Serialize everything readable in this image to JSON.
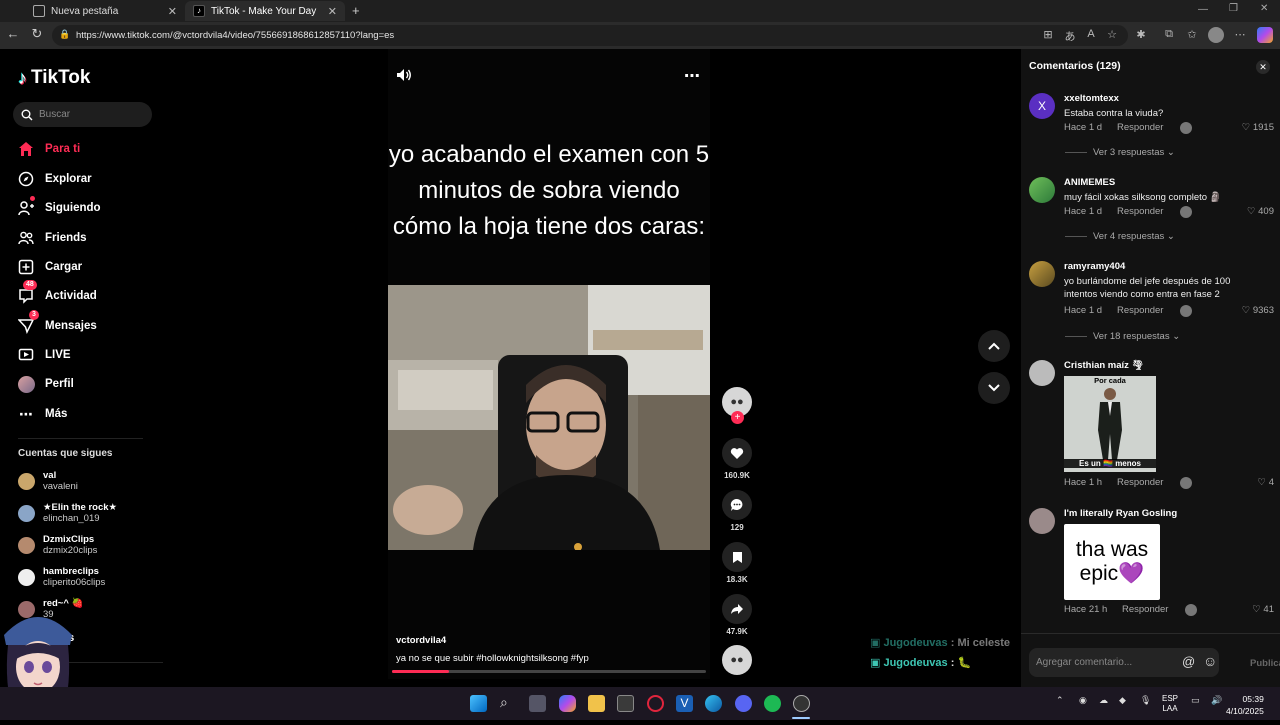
{
  "browser": {
    "tabs": [
      {
        "title": "Nueva pestaña"
      },
      {
        "title": "TikTok - Make Your Day"
      }
    ],
    "url": "https://www.tiktok.com/@vctordvila4/video/7556691868612857110?lang=es"
  },
  "sidebar": {
    "logo": "TikTok",
    "search_placeholder": "Buscar",
    "nav": [
      {
        "label": "Para ti",
        "icon": "home-icon"
      },
      {
        "label": "Explorar",
        "icon": "compass-icon"
      },
      {
        "label": "Siguiendo",
        "icon": "following-icon"
      },
      {
        "label": "Friends",
        "icon": "friends-icon"
      },
      {
        "label": "Cargar",
        "icon": "upload-icon"
      },
      {
        "label": "Actividad",
        "icon": "activity-icon",
        "badge": "48"
      },
      {
        "label": "Mensajes",
        "icon": "messages-icon",
        "badge": "3"
      },
      {
        "label": "LIVE",
        "icon": "live-icon"
      },
      {
        "label": "Perfil",
        "icon": "profile-icon"
      },
      {
        "label": "Más",
        "icon": "more-icon"
      }
    ],
    "following_header": "Cuentas que sigues",
    "following": [
      {
        "name": "val",
        "handle": "vavaleni"
      },
      {
        "name": "★Elin the rock★",
        "handle": "elinchan_019"
      },
      {
        "name": "DzmixClips",
        "handle": "dzmix20clips"
      },
      {
        "name": "hambreclips",
        "handle": "cliperito06clips"
      },
      {
        "name": "red~^ 🍓",
        "handle": "39"
      }
    ],
    "more_label": "ás"
  },
  "video": {
    "caption": "yo acabando el examen con 5 minutos de sobra viendo cómo la hoja tiene dos caras:",
    "author": "vctordvila4",
    "description": "ya no se que subir #hollowknightsilksong  #fyp",
    "progress": 0.18,
    "likes": "160.9K",
    "comments": "129",
    "saves": "18.3K",
    "shares": "47.9K"
  },
  "comments_panel": {
    "title": "Comentarios (129)",
    "items": [
      {
        "user": "xxeltomtexx",
        "text": "Estaba contra la viuda?",
        "time": "Hace 1 d",
        "reply": "Responder",
        "likes": "1915",
        "more": "Ver 3 respuestas",
        "avatar_letter": "X"
      },
      {
        "user": "ANIMEMES",
        "text": "muy fácil xokas silksong completo 🗿",
        "time": "Hace 1 d",
        "reply": "Responder",
        "likes": "409",
        "more": "Ver 4 respuestas"
      },
      {
        "user": "ramyramy404",
        "text": "yo burlándome del jefe después de 100 intentos viendo como entra en fase 2",
        "time": "Hace 1 d",
        "reply": "Responder",
        "likes": "9363",
        "more": "Ver 18 respuestas"
      },
      {
        "user": "Cristhian maíz 🌪",
        "sticker_top": "Por cada",
        "sticker_bottom": "Es un 🏳️‍🌈 menos",
        "time": "Hace 1 h",
        "reply": "Responder",
        "likes": "4"
      },
      {
        "user": "I'm literally Ryan Gosling",
        "sticker_text": "tha was epic💜",
        "time": "Hace 21 h",
        "reply": "Responder",
        "likes": "41"
      }
    ],
    "input_placeholder": "Agregar comentario...",
    "publish": "Publicar"
  },
  "chat_overlay": [
    {
      "user": "Jugodeuvas",
      "text": ": Mi celeste"
    },
    {
      "user": "Jugodeuvas",
      "text": ": 🐛"
    }
  ],
  "taskbar": {
    "lang1": "ESP",
    "lang2": "LAA",
    "time": "05:39",
    "date": "4/10/2025"
  },
  "colors": {
    "accent": "#fe2c55",
    "panel": "#121212",
    "chat_name": "#3ec7b4"
  }
}
